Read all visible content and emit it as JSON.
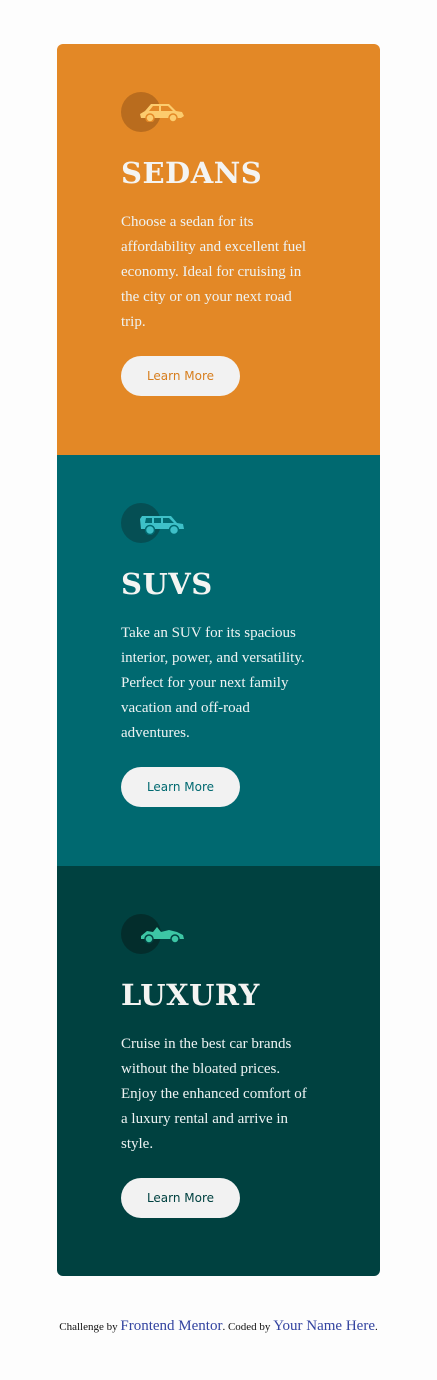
{
  "cards": [
    {
      "title": "SEDANS",
      "description": "Choose a sedan for its affordability and excellent fuel economy. Ideal for cruising in the city or on your next road trip.",
      "button_label": "Learn More",
      "icon": "sedan-car-icon",
      "color": "#e38826"
    },
    {
      "title": "SUVS",
      "description": "Take an SUV for its spacious interior, power, and versatility. Perfect for your next family vacation and off-road adventures.",
      "button_label": "Learn More",
      "icon": "suv-car-icon",
      "color": "#006970"
    },
    {
      "title": "LUXURY",
      "description": "Cruise in the best car brands without the bloated prices. Enjoy the enhanced comfort of a luxury rental and arrive in style.",
      "button_label": "Learn More",
      "icon": "luxury-car-icon",
      "color": "#004140"
    }
  ],
  "footer": {
    "challenge_prefix": "Challenge by",
    "challenge_link": "Frontend Mentor",
    "coded_prefix": ". Coded by",
    "author_link": "Your Name Here",
    "suffix": "."
  }
}
